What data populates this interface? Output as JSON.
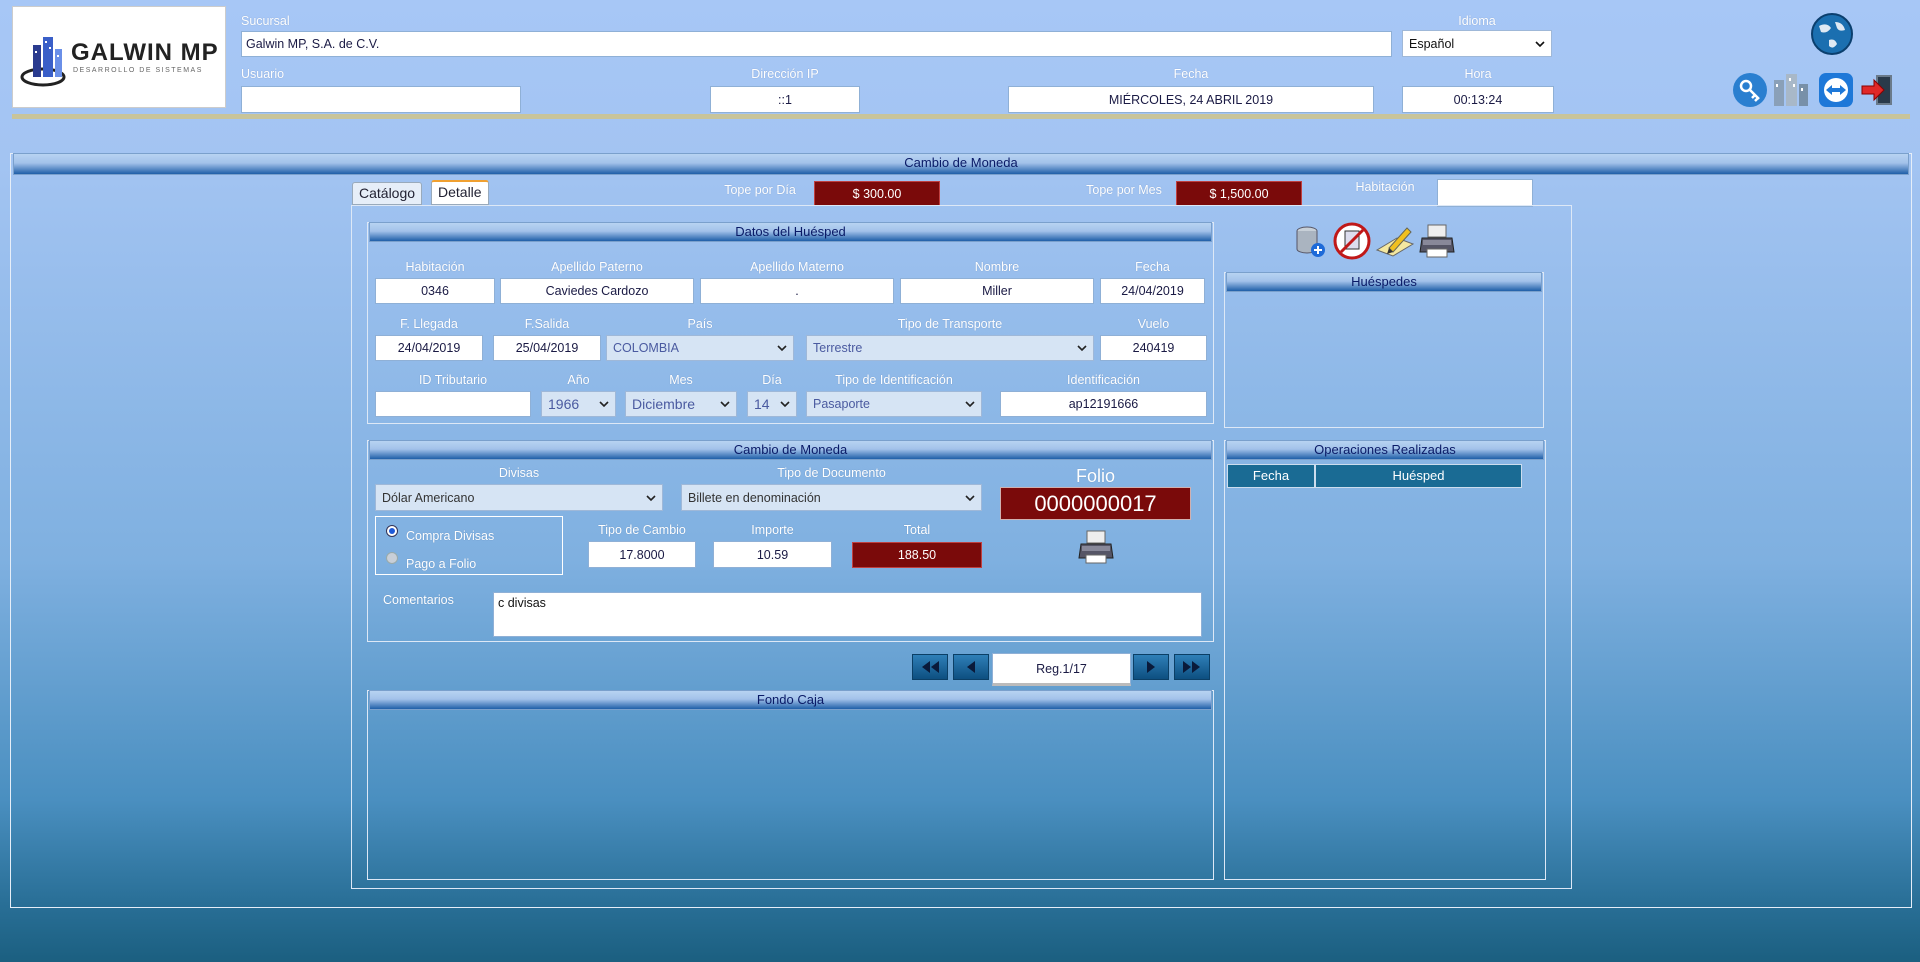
{
  "brand": {
    "name": "GALWIN MP",
    "sub": "DESARROLLO DE SISTEMAS"
  },
  "header": {
    "sucursal_label": "Sucursal",
    "sucursal_value": "Galwin MP, S.A. de C.V.",
    "idioma_label": "Idioma",
    "idioma_value": "Español",
    "usuario_label": "Usuario",
    "usuario_value": "",
    "ip_label": "Dirección IP",
    "ip_value": "::1",
    "fecha_label": "Fecha",
    "fecha_value": "MIÉRCOLES, 24 ABRIL 2019",
    "hora_label": "Hora",
    "hora_value": "00:13:24"
  },
  "icons": [
    "globe-icon",
    "key-icon",
    "buildings-icon",
    "teamviewer-icon",
    "exit-icon"
  ],
  "page": {
    "title": "Cambio de Moneda"
  },
  "tabs": [
    "Catálogo",
    "Detalle"
  ],
  "topes": {
    "dia_label": "Tope por Día",
    "dia_value": "$ 300.00",
    "mes_label": "Tope por Mes",
    "mes_value": "$ 1,500.00",
    "hab_label": "Habitación",
    "hab_value": ""
  },
  "huesped": {
    "title": "Datos del Huésped",
    "habitacion_label": "Habitación",
    "habitacion": "0346",
    "paterno_label": "Apellido Paterno",
    "paterno": "Caviedes Cardozo",
    "materno_label": "Apellido Materno",
    "materno": ".",
    "nombre_label": "Nombre",
    "nombre": "Miller",
    "fecha_label": "Fecha",
    "fecha": "24/04/2019",
    "llegada_label": "F. Llegada",
    "llegada": "24/04/2019",
    "salida_label": "F.Salida",
    "salida": "25/04/2019",
    "pais_label": "País",
    "pais": "COLOMBIA",
    "transporte_label": "Tipo de Transporte",
    "transporte": "Terrestre",
    "vuelo_label": "Vuelo",
    "vuelo": "240419",
    "tributario_label": "ID Tributario",
    "tributario": "",
    "anio_label": "Año",
    "anio": "1966",
    "mes_label": "Mes",
    "mes": "Diciembre",
    "dia_label": "Día",
    "dia": "14",
    "tipo_id_label": "Tipo de Identificación",
    "tipo_id": "Pasaporte",
    "id_label": "Identificación",
    "id": "ap12191666"
  },
  "cambio": {
    "title": "Cambio de Moneda",
    "divisas_label": "Divisas",
    "divisas": "Dólar Americano",
    "tipo_doc_label": "Tipo de Documento",
    "tipo_doc": "Billete en denominación",
    "folio_label": "Folio",
    "folio": "0000000017",
    "compra_label": "Compra Divisas",
    "pago_label": "Pago a Folio",
    "tipo_cambio_label": "Tipo de Cambio",
    "tipo_cambio": "17.8000",
    "importe_label": "Importe",
    "importe": "10.59",
    "total_label": "Total",
    "total": "188.50",
    "comentarios_label": "Comentarios",
    "comentarios": "c divisas"
  },
  "nav": {
    "record": "Reg.1/17"
  },
  "fondo": {
    "title": "Fondo Caja"
  },
  "huespedes": {
    "title": "Huéspedes"
  },
  "operaciones": {
    "title": "Operaciones Realizadas",
    "col_fecha": "Fecha",
    "col_huesped": "Huésped"
  },
  "colors": {
    "accent_red": "#7a0a0a",
    "header_teal": "#1a6b94"
  }
}
